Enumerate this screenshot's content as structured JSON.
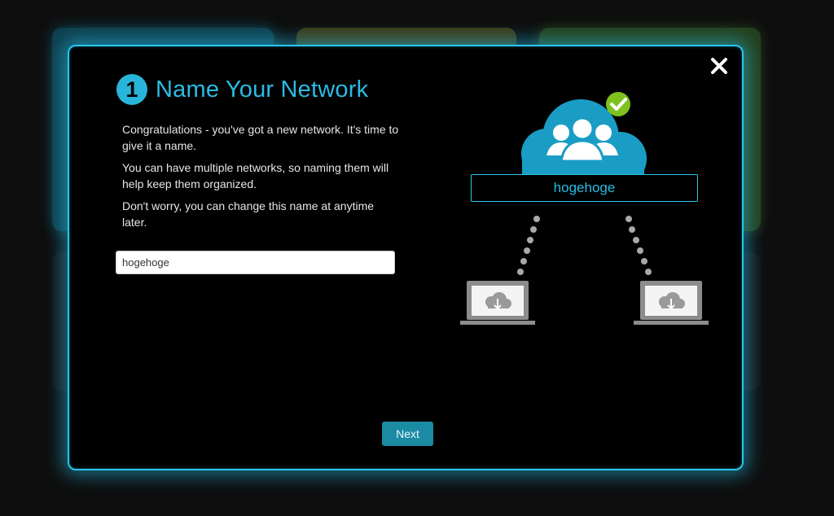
{
  "colors": {
    "accent": "#29c6ea",
    "accent_dark": "#1b8ba4",
    "check_green": "#7dc21e",
    "laptop_gray": "#8c8c8c"
  },
  "wizard": {
    "step_number": "1",
    "title": "Name Your Network",
    "paragraphs": [
      "Congratulations - you've got a new network. It's time to give it a name.",
      "You can have multiple networks, so naming them will help keep them organized.",
      "Don't worry, you can change this name at anytime later."
    ],
    "network_name_value": "hogehoge",
    "next_label": "Next"
  },
  "diagram": {
    "network_label": "hogehoge",
    "icons": [
      "cloud-group-icon",
      "check-icon",
      "laptop-icon",
      "download-icon"
    ]
  }
}
